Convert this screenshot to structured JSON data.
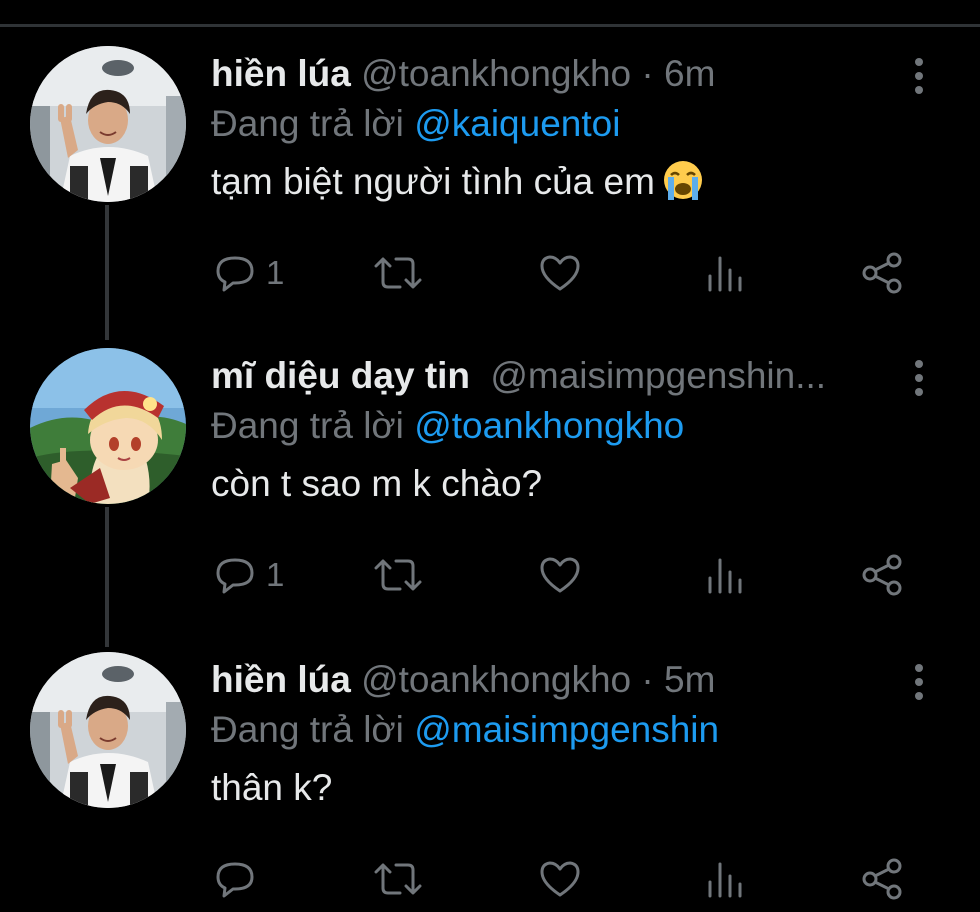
{
  "colors": {
    "background": "#000000",
    "text_primary": "#e7e9ea",
    "text_secondary": "#71767b",
    "accent": "#1d9bf0",
    "thread_line": "#333639"
  },
  "tweets": [
    {
      "display_name": "hiền lúa",
      "handle": "@toankhongkho",
      "separator": "·",
      "time": "6m",
      "reply_prefix": "Đang trả lời",
      "reply_to": "@kaiquentoi",
      "text": "tạm biệt người tình của em",
      "emoji": "loudly-crying-face",
      "reply_count": "1",
      "avatar_icon": "profile-photo-man-peace-sign"
    },
    {
      "display_name": "mĩ diệu dạy tin",
      "handle": "@maisimpgenshin...",
      "separator": "",
      "time": "",
      "reply_prefix": "Đang trả lời",
      "reply_to": "@toankhongkho",
      "text": "còn t sao m k chào?",
      "emoji": "",
      "reply_count": "1",
      "avatar_icon": "anime-girl-red-hat"
    },
    {
      "display_name": "hiền lúa",
      "handle": "@toankhongkho",
      "separator": "·",
      "time": "5m",
      "reply_prefix": "Đang trả lời",
      "reply_to": "@maisimpgenshin",
      "text": "thân k?",
      "emoji": "",
      "reply_count": "",
      "avatar_icon": "profile-photo-man-peace-sign"
    }
  ],
  "action_icons": [
    "reply-icon",
    "retweet-icon",
    "like-icon",
    "views-icon",
    "share-icon"
  ]
}
